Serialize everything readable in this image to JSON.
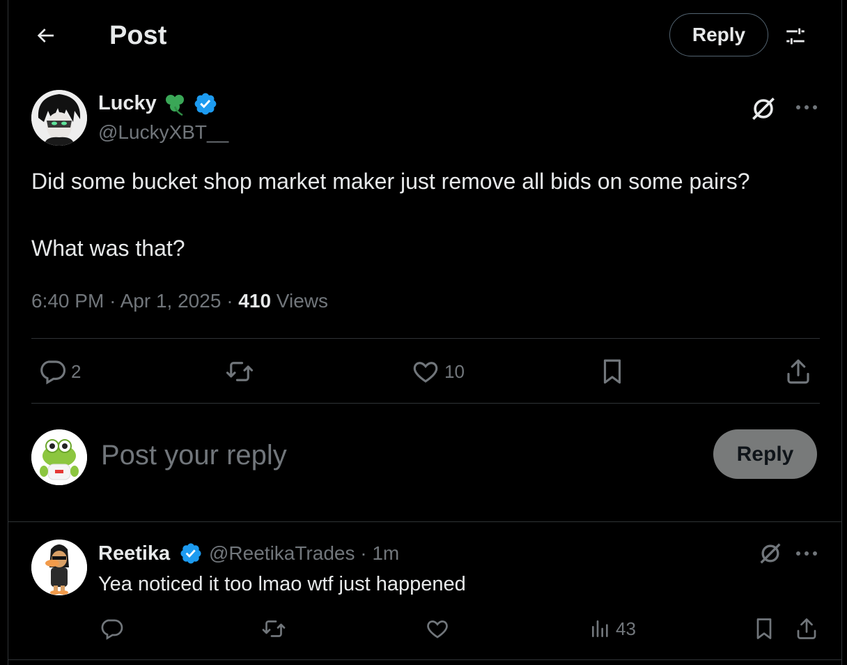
{
  "header": {
    "title": "Post",
    "reply_label": "Reply",
    "back_icon": "arrow-left-icon",
    "filter_icon": "sliders-icon"
  },
  "post": {
    "author": {
      "name": "Lucky",
      "emoji": "☘️",
      "handle": "@LuckyXBT__",
      "verified": true
    },
    "text_line1": "Did some bucket shop market maker just remove all bids on some pairs?",
    "text_line2": "What was that?",
    "time": "6:40 PM",
    "date": "Apr 1, 2025",
    "views_count": "410",
    "views_label": "Views",
    "stats": {
      "replies": "2",
      "likes": "10"
    }
  },
  "composer": {
    "placeholder": "Post your reply",
    "submit_label": "Reply"
  },
  "replies": [
    {
      "name": "Reetika",
      "handle": "@ReetikaTrades",
      "time": "1m",
      "verified": true,
      "text": "Yea noticed it too lmao wtf just happened",
      "views": "43"
    }
  ],
  "colors": {
    "background": "#000000",
    "text": "#e7e9ea",
    "muted": "#71767b",
    "border": "#2f3336",
    "verified": "#1d9bf0",
    "reply_button_disabled": "#787a7a"
  }
}
